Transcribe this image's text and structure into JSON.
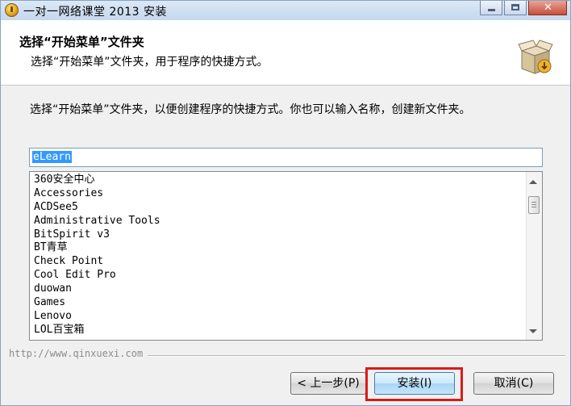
{
  "window": {
    "title": "一对一网络课堂 2013 安装"
  },
  "header": {
    "title": "选择“开始菜单”文件夹",
    "subtitle": "选择“开始菜单”文件夹，用于程序的快捷方式。"
  },
  "body": {
    "instructions": "选择“开始菜单”文件夹，以便创建程序的快捷方式。你也可以输入名称，创建新文件夹。"
  },
  "folder_input": {
    "value": "eLearn"
  },
  "folder_list": {
    "items": [
      "360安全中心",
      "Accessories",
      "ACDSee5",
      "Administrative Tools",
      "BitSpirit v3",
      "BT青草",
      "Check Point",
      "Cool Edit Pro",
      "duowan",
      "Games",
      "Lenovo",
      "LOL百宝箱"
    ]
  },
  "branding": {
    "text": "http://www.qinxuexi.com"
  },
  "buttons": {
    "back": "< 上一步(P)",
    "install": "安装(I)",
    "cancel": "取消(C)"
  },
  "colors": {
    "highlight": "#d81b1b",
    "selection": "#3399ff"
  },
  "icons": {
    "app": "installer-app-icon",
    "header": "install-box-icon"
  }
}
